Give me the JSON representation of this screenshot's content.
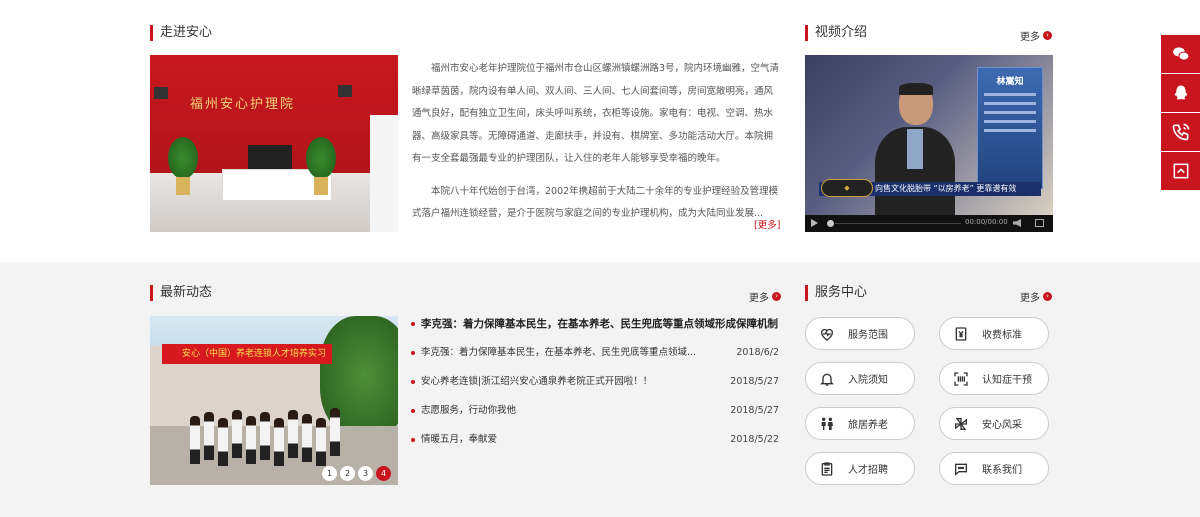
{
  "intro": {
    "title": "走进安心",
    "photo_sign": "福州安心护理院",
    "paragraph1": "福州市安心老年护理院位于福州市仓山区螺洲镇螺洲路3号，院内环境幽雅，空气清晰绿草茵茵，院内设有单人间、双人间、三人间、七人间套间等，房间宽敞明亮，通风通气良好，配有独立卫生间，床头呼叫系统，衣柜等设施。家电有：电视、空调、热水器、高级家具等。无障碍通道、走廊扶手，并设有、棋牌室、多功能活动大厅。本院拥有一支全套最强最专业的护理团队，让入住的老年人能够享受幸福的晚年。",
    "paragraph2": "本院八十年代始创于台湾，2002年携超前于大陆二十余年的专业护理经验及管理模式落户福州连锁经营，是介于医院与家庭之间的专业护理机构，成为大陆同业发展...",
    "more_link": "[更多]"
  },
  "video": {
    "title": "视频介绍",
    "more": "更多",
    "panel_name": "林嵩知",
    "caption": "向售文化脱胎带 “以房养老” 更靠谱有效",
    "time": "00:00/00:00"
  },
  "news": {
    "title": "最新动态",
    "more": "更多",
    "banner": "安心（中国）养老连锁人才培养实习",
    "headline": "李克强：着力保障基本民生，在基本养老、民生兜底等重点领域形成保障机制",
    "items": [
      {
        "text": "李克强：着力保障基本民生，在基本养老、民生兜底等重点领域...",
        "date": "2018/6/2"
      },
      {
        "text": "安心养老连锁|浙江绍兴安心通泉养老院正式开园啦！！",
        "date": "2018/5/27"
      },
      {
        "text": "志愿服务，行动你我他",
        "date": "2018/5/27"
      },
      {
        "text": "情暖五月，奉献爱",
        "date": "2018/5/22"
      }
    ],
    "slides": [
      "1",
      "2",
      "3",
      "4"
    ]
  },
  "services": {
    "title": "服务中心",
    "more": "更多",
    "items": [
      {
        "label": "服务范围",
        "icon": "heart-pulse-icon"
      },
      {
        "label": "收费标准",
        "icon": "yen-document-icon"
      },
      {
        "label": "入院须知",
        "icon": "bell-icon"
      },
      {
        "label": "认知症干预",
        "icon": "scan-icon"
      },
      {
        "label": "旅居养老",
        "icon": "people-icon"
      },
      {
        "label": "安心风采",
        "icon": "pinwheel-icon"
      },
      {
        "label": "人才招聘",
        "icon": "clipboard-icon"
      },
      {
        "label": "联系我们",
        "icon": "chat-icon"
      }
    ]
  },
  "side_toolbar": [
    "wechat-icon",
    "qq-icon",
    "phone-icon",
    "back-to-top-icon"
  ],
  "colors": {
    "accent": "#c9151e",
    "bottom_band": "#f4f3f3"
  }
}
